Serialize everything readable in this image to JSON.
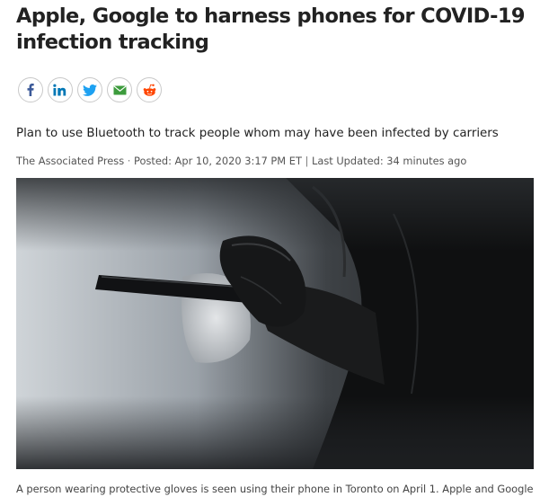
{
  "article": {
    "headline_line1": "Apple, Google to harness phones for COVID-19",
    "headline_line2": "infection tracking",
    "dek": "Plan to use Bluetooth to track people whom may have been infected by carriers",
    "byline": {
      "author": "The Associated Press",
      "posted_label": "Posted: Apr 10, 2020 3:17 PM ET",
      "updated_label": "Last Updated: 34 minutes ago"
    },
    "caption": "A person wearing protective gloves is seen using their phone in Toronto on April 1. Apple and Google"
  },
  "share": {
    "buttons": [
      {
        "icon": "facebook-icon"
      },
      {
        "icon": "linkedin-icon"
      },
      {
        "icon": "twitter-icon"
      },
      {
        "icon": "email-icon"
      },
      {
        "icon": "reddit-icon"
      }
    ]
  },
  "colors": {
    "facebook": "#3b5998",
    "linkedin": "#0077b5",
    "twitter": "#1da1f2",
    "email": "#3c9b3c",
    "reddit": "#ff4500"
  }
}
